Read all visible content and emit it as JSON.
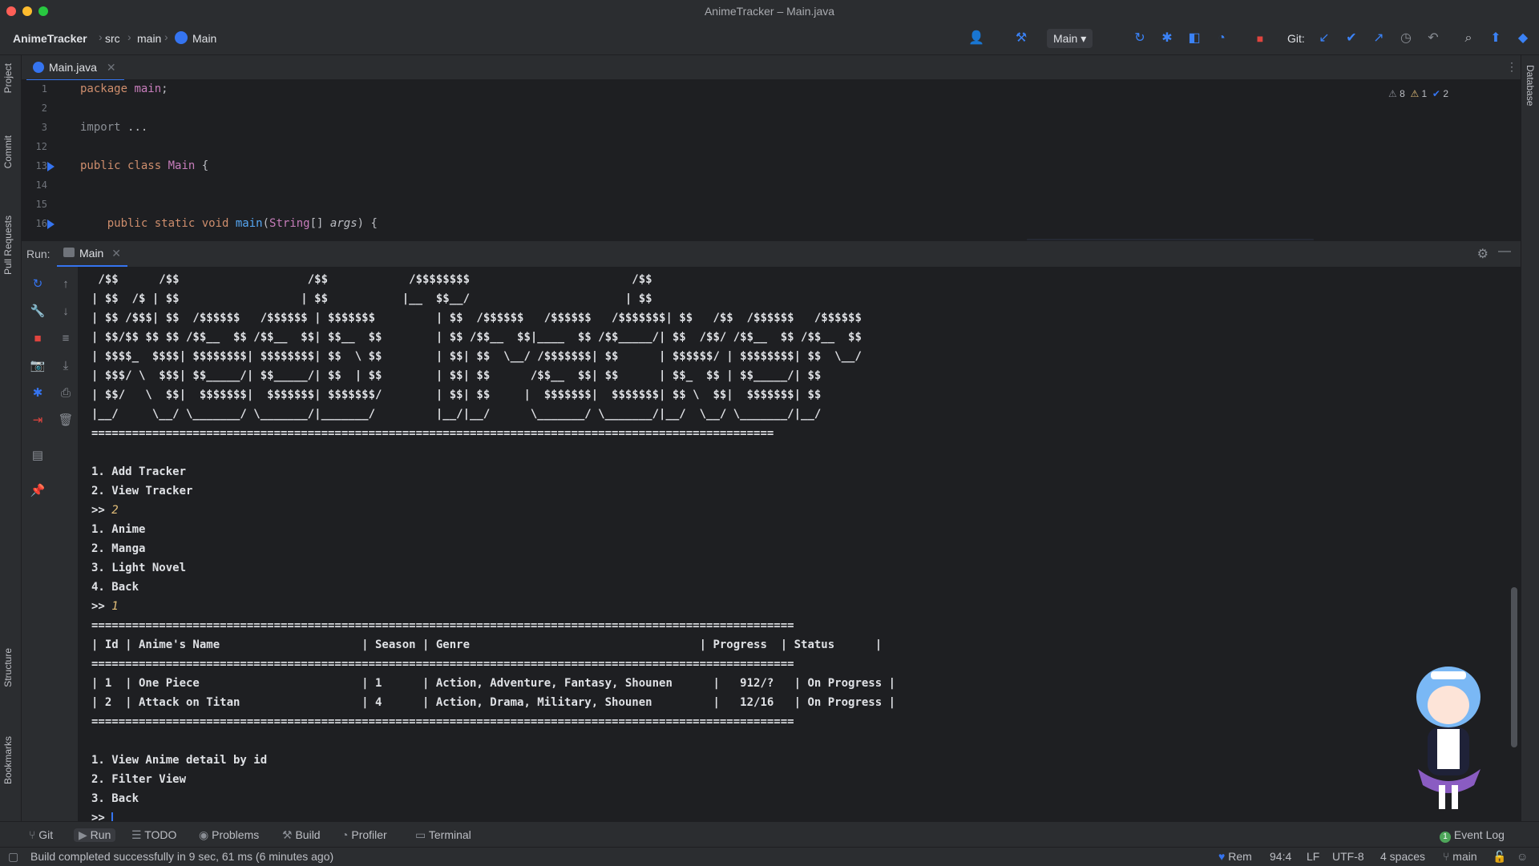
{
  "window": {
    "title": "AnimeTracker – Main.java"
  },
  "breadcrumb": {
    "project": "AnimeTracker",
    "dir1": "src",
    "dir2": "main",
    "file": "Main"
  },
  "toolbar": {
    "run_config": "Main",
    "git_label": "Git:"
  },
  "left_stripe": {
    "project": "Project",
    "commit": "Commit",
    "pull_requests": "Pull Requests",
    "structure": "Structure",
    "bookmarks": "Bookmarks"
  },
  "right_stripe": {
    "database": "Database"
  },
  "editor": {
    "tab_label": "Main.java",
    "inspections": {
      "weak_warnings": "8",
      "warnings": "1",
      "typos": "2"
    },
    "lines": [
      {
        "num": "1",
        "code": "package main;"
      },
      {
        "num": "2",
        "code": ""
      },
      {
        "num": "3",
        "code": "import ..."
      },
      {
        "num": "12",
        "code": ""
      },
      {
        "num": "13",
        "code": "public class Main {"
      },
      {
        "num": "14",
        "code": ""
      },
      {
        "num": "15",
        "code": ""
      },
      {
        "num": "16",
        "code": "    public static void main(String[] args) {"
      }
    ]
  },
  "run_panel": {
    "label": "Run:",
    "tab_label": "Main",
    "console": [
      " /$$      /$$                   /$$            /$$$$$$$$                        /$$",
      "| $$  /$ | $$                  | $$           |__  $$__/                       | $$",
      "| $$ /$$$| $$  /$$$$$$   /$$$$$$ | $$$$$$$         | $$  /$$$$$$   /$$$$$$   /$$$$$$$| $$   /$$  /$$$$$$   /$$$$$$",
      "| $$/$$ $$ $$ /$$__  $$ /$$__  $$| $$__  $$        | $$ /$$__  $$|____  $$ /$$_____/| $$  /$$/ /$$__  $$ /$$__  $$",
      "| $$$$_  $$$$| $$$$$$$$| $$$$$$$$| $$  \\ $$        | $$| $$  \\__/ /$$$$$$$| $$      | $$$$$$/ | $$$$$$$$| $$  \\__/",
      "| $$$/ \\  $$$| $$_____/| $$_____/| $$  | $$        | $$| $$      /$$__  $$| $$      | $$_  $$ | $$_____/| $$",
      "| $$/   \\  $$|  $$$$$$$|  $$$$$$$| $$$$$$$/        | $$| $$     |  $$$$$$$|  $$$$$$$| $$ \\  $$|  $$$$$$$| $$",
      "|__/     \\__/ \\_______/ \\_______/|_______/         |__/|__/      \\_______/ \\_______/|__/  \\__/ \\_______/|__/",
      "=====================================================================================================",
      "",
      "1. Add Tracker",
      "2. View Tracker",
      ">> 2",
      "1. Anime",
      "2. Manga",
      "3. Light Novel",
      "4. Back",
      ">> 1",
      "========================================================================================================",
      "| Id | Anime's Name                     | Season | Genre                                  | Progress  | Status      |",
      "========================================================================================================",
      "| 1  | One Piece                        | 1      | Action, Adventure, Fantasy, Shounen      |   912/?   | On Progress |",
      "| 2  | Attack on Titan                  | 4      | Action, Drama, Military, Shounen         |   12/16   | On Progress |",
      "========================================================================================================",
      "",
      "1. View Anime detail by id",
      "2. Filter View",
      "3. Back",
      ">> "
    ]
  },
  "bottom_tools": {
    "git": "Git",
    "run": "Run",
    "todo": "TODO",
    "problems": "Problems",
    "build": "Build",
    "profiler": "Profiler",
    "terminal": "Terminal",
    "event_log": "Event Log",
    "event_count": "1"
  },
  "status": {
    "message": "Build completed successfully in 9 sec, 61 ms (6 minutes ago)",
    "theme": "Rem",
    "position": "94:4",
    "line_sep": "LF",
    "encoding": "UTF-8",
    "indent": "4 spaces",
    "branch": "main"
  },
  "colors": {
    "accent": "#3574f0",
    "console_input": "#e5c07b",
    "stop_red": "#e0443e"
  }
}
